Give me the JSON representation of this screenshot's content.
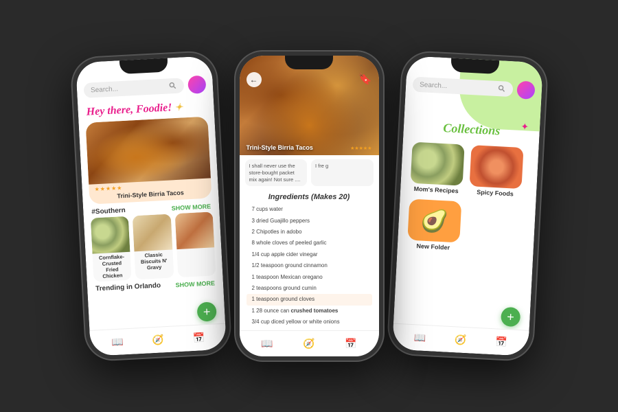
{
  "phones": {
    "left": {
      "search_placeholder": "Search...",
      "greeting": "Hey there, Foodie!",
      "sparkle": "✦",
      "hero_recipe": "Trini-Style Birria Tacos",
      "stars": [
        "★",
        "★",
        "★",
        "★",
        "★"
      ],
      "section_tag": "#Southern",
      "show_more": "SHOW MORE",
      "food_cards": [
        {
          "title": "Cornflake-Crusted Fried Chicken"
        },
        {
          "title": "Classic Biscuits N' Gravy"
        },
        {
          "title": ""
        }
      ],
      "trending_label": "Trending in Orlando",
      "trending_show_more": "SHOW MORE",
      "fab_label": "+",
      "nav_icons": [
        "📖",
        "🔍",
        "📅"
      ]
    },
    "center": {
      "back_icon": "←",
      "bookmark_icon": "🔖",
      "recipe_title": "Trini-Style Birria Tacos",
      "stars": [
        "★",
        "★",
        "★",
        "★",
        "★"
      ],
      "review_1": "I shall never use the store-bought packet mix again! Not sure ....",
      "review_2": "I fre g",
      "ingredients_title": "Ingredients (Makes 20)",
      "ingredients": [
        {
          "text": "7 cups water",
          "highlight": false
        },
        {
          "text": "3 dried Guajillo peppers",
          "highlight": false
        },
        {
          "text": "2 Chipotles in adobo",
          "highlight": false
        },
        {
          "text": "8 whole cloves of peeled garlic",
          "highlight": false
        },
        {
          "text": "1/4 cup apple cider vinegar",
          "highlight": false
        },
        {
          "text": "1/2 teaspoon ground cinnamon",
          "highlight": false
        },
        {
          "text": "1 teaspoon Mexican oregano",
          "highlight": false
        },
        {
          "text": "2 teaspoons ground cumin",
          "highlight": false
        },
        {
          "text": "1 teaspoon ground cloves",
          "highlight": true
        },
        {
          "text": "1 28 ounce can crushed tomatoes",
          "highlight": false
        },
        {
          "text": "3/4 cup diced yellow or white onions",
          "highlight": false
        }
      ],
      "nav_icons": [
        "📖",
        "🔍",
        "📅"
      ]
    },
    "right": {
      "search_placeholder": "Search...",
      "collections_title": "Collections",
      "sparkle": "✦",
      "collections": [
        {
          "label": "Mom's Recipes"
        },
        {
          "label": "Spicy Foods"
        },
        {
          "label": "New Folder"
        }
      ],
      "fab_label": "+",
      "nav_icons": [
        "📖",
        "🔍",
        "📅"
      ]
    }
  }
}
